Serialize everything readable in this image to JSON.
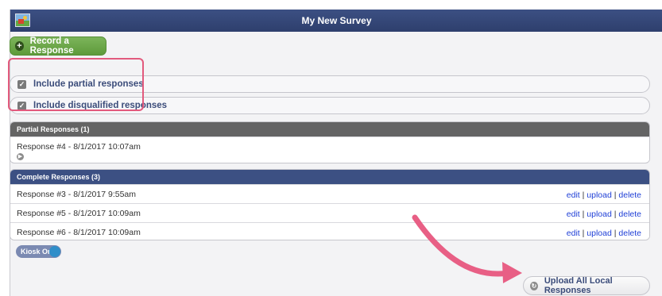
{
  "window": {
    "title": "My New Survey",
    "icon": "survey-app-icon"
  },
  "record_button": {
    "label": "Record a Response",
    "icon": "plus-circle-icon",
    "color": "#6aa646"
  },
  "options": [
    {
      "label": "Include partial responses",
      "checked": true
    },
    {
      "label": "Include disqualified responses",
      "checked": true
    }
  ],
  "partial_panel": {
    "header": "Partial Responses (1)",
    "rows": [
      {
        "label": "Response #4 - 8/1/2017 10:07am",
        "icon": "go-arrow-icon"
      }
    ]
  },
  "complete_panel": {
    "header": "Complete Responses (3)",
    "rows": [
      {
        "label": "Response #3 - 8/1/2017 9:55am",
        "edit": "edit",
        "sep1": " | ",
        "upload": "upload",
        "sep2": " | ",
        "delete": "delete"
      },
      {
        "label": "Response #5 - 8/1/2017 10:09am",
        "edit": "edit",
        "sep1": " | ",
        "upload": "upload",
        "sep2": " | ",
        "delete": "delete"
      },
      {
        "label": "Response #6 - 8/1/2017 10:09am",
        "edit": "edit",
        "sep1": " | ",
        "upload": "upload",
        "sep2": " | ",
        "delete": "delete"
      }
    ]
  },
  "kiosk_toggle": {
    "label": "Kiosk On",
    "on": true
  },
  "upload_all_button": {
    "label": "Upload All Local Responses",
    "icon": "upload-circle-icon"
  },
  "colors": {
    "titlebar": "#34477a",
    "highlight": "#e25a7d",
    "link": "#1f3fd6",
    "partial_header": "#646464",
    "complete_header": "#3c5083"
  }
}
